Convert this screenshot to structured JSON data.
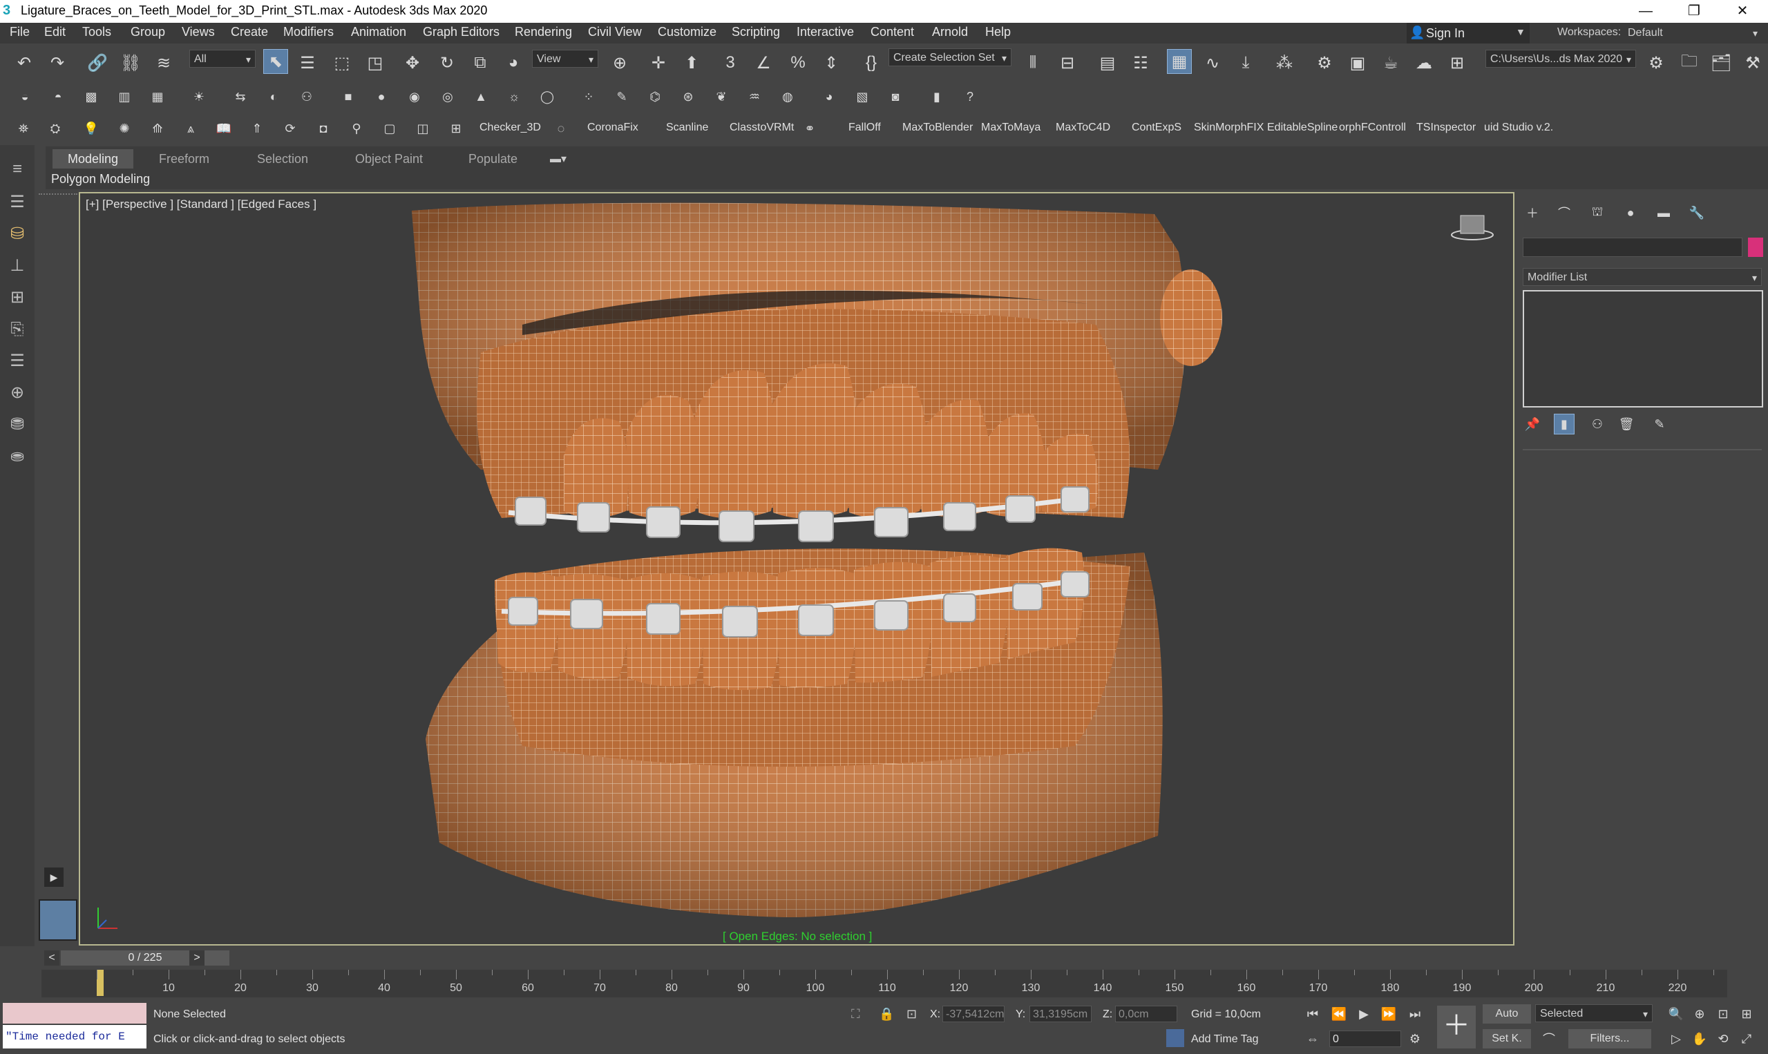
{
  "window": {
    "title": "Ligature_Braces_on_Teeth_Model_for_3D_Print_STL.max - Autodesk 3ds Max 2020",
    "app_icon": "3",
    "minimize": "—",
    "maximize": "❐",
    "close": "✕"
  },
  "menu": [
    "File",
    "Edit",
    "Tools",
    "Group",
    "Views",
    "Create",
    "Modifiers",
    "Animation",
    "Graph Editors",
    "Rendering",
    "Civil View",
    "Customize",
    "Scripting",
    "Interactive",
    "Content",
    "Arnold",
    "Help"
  ],
  "sign_in": "Sign In",
  "workspaces_label": "Workspaces:",
  "workspace_value": "Default",
  "toolbar": {
    "selection_filter": "All",
    "ref_coord": "View",
    "named_selection": "Create Selection Set",
    "project_path": "C:\\Users\\Us...ds Max 2020"
  },
  "plugins": [
    "Checker_3D",
    "CoronaFix",
    "Scanline",
    "ClasstoVRMt",
    "FallOff",
    "MaxToBlender",
    "MaxToMaya",
    "MaxToC4D",
    "ContExpS",
    "SkinMorphFIX",
    "EditableSpline",
    "orphFControll",
    "TSInspector",
    "uid Studio v.2."
  ],
  "ribbon_tabs": [
    "Modeling",
    "Freeform",
    "Selection",
    "Object Paint",
    "Populate"
  ],
  "ribbon_panel": "Polygon Modeling",
  "viewport": {
    "label": "[+] [Perspective ] [Standard ] [Edged Faces ]",
    "status": "[ Open Edges: No selection ]",
    "wire_color": "#d4864a"
  },
  "command_panel": {
    "modifier_list": "Modifier List"
  },
  "time_slider": {
    "label": "0 / 225",
    "prev": "<",
    "next": ">"
  },
  "track_labels": [
    "10",
    "20",
    "30",
    "40",
    "50",
    "60",
    "70",
    "80",
    "90",
    "100",
    "110",
    "120",
    "130",
    "140",
    "150",
    "160",
    "170",
    "180",
    "190",
    "200",
    "210",
    "220"
  ],
  "status": {
    "script_text": "\"Time needed for E",
    "selection": "None Selected",
    "prompt": "Click or click-and-drag to select objects",
    "x_label": "X:",
    "x_value": "-37,5412cm",
    "y_label": "Y:",
    "y_value": "31,3195cm",
    "z_label": "Z:",
    "z_value": "0,0cm",
    "grid": "Grid = 10,0cm",
    "add_time_tag": "Add Time Tag",
    "auto": "Auto",
    "selected": "Selected",
    "set_key": "Set K.",
    "filters": "Filters...",
    "frame": "0"
  },
  "accent_color": "#5b7fa6"
}
